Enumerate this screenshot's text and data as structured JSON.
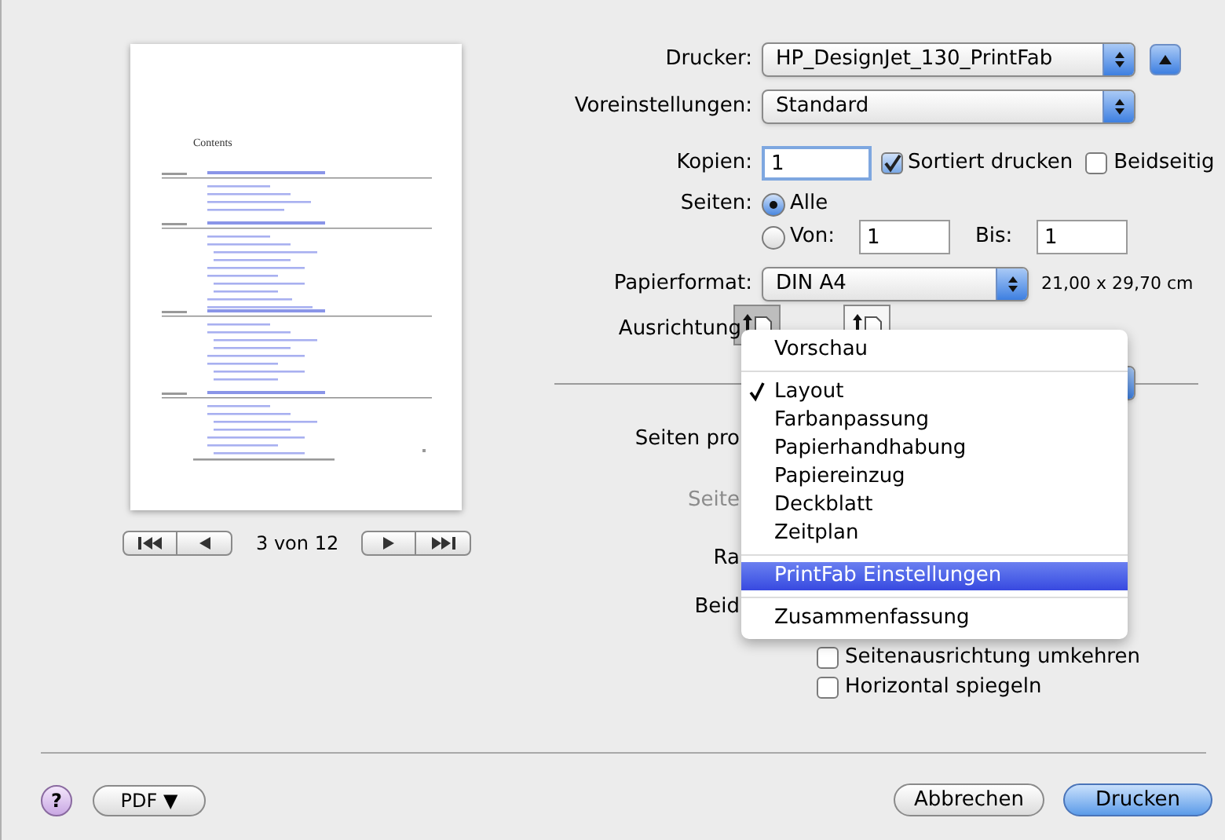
{
  "preview": {
    "heading": "Contents",
    "page_indicator": "3 von 12"
  },
  "printer": {
    "label": "Drucker:",
    "value": "HP_DesignJet_130_PrintFab",
    "expanded": true
  },
  "presets": {
    "label": "Voreinstellungen:",
    "value": "Standard"
  },
  "copies": {
    "label": "Kopien:",
    "value": "1"
  },
  "collate": {
    "label": "Sortiert drucken",
    "checked": true
  },
  "two_sided": {
    "label": "Beidseitig",
    "checked": false
  },
  "pages": {
    "label": "Seiten:",
    "options": [
      {
        "label": "Alle",
        "selected": true
      },
      {
        "label": "Von:",
        "selected": false
      }
    ],
    "from_value": "1",
    "to_label": "Bis:",
    "to_value": "1"
  },
  "paper_size": {
    "label": "Papierformat:",
    "value": "DIN A4",
    "dimensions": "21,00 x 29,70 cm"
  },
  "orientation": {
    "label": "Ausrichtung",
    "options": [
      {
        "selected": true
      },
      {
        "selected": false
      }
    ]
  },
  "layout_rows": [
    {
      "label": "Seiten pro",
      "disabled": false
    },
    {
      "label": "Seite",
      "disabled": true
    },
    {
      "label": "Ra",
      "disabled": false
    },
    {
      "label": "Beid",
      "disabled": false
    }
  ],
  "layout_checkboxes": [
    {
      "label": "Seitenausrichtung umkehren",
      "checked": false
    },
    {
      "label": "Horizontal spiegeln",
      "checked": false
    }
  ],
  "menu": {
    "items": [
      {
        "kind": "item",
        "label": "Vorschau",
        "checked": false,
        "selected": false
      },
      {
        "kind": "separator"
      },
      {
        "kind": "item",
        "label": "Layout",
        "checked": true,
        "selected": false
      },
      {
        "kind": "item",
        "label": "Farbanpassung",
        "checked": false,
        "selected": false
      },
      {
        "kind": "item",
        "label": "Papierhandhabung",
        "checked": false,
        "selected": false
      },
      {
        "kind": "item",
        "label": "Papiereinzug",
        "checked": false,
        "selected": false
      },
      {
        "kind": "item",
        "label": "Deckblatt",
        "checked": false,
        "selected": false
      },
      {
        "kind": "item",
        "label": "Zeitplan",
        "checked": false,
        "selected": false
      },
      {
        "kind": "separator"
      },
      {
        "kind": "item",
        "label": "PrintFab Einstellungen",
        "checked": false,
        "selected": true
      },
      {
        "kind": "separator"
      },
      {
        "kind": "item",
        "label": "Zusammenfassung",
        "checked": false,
        "selected": false
      }
    ]
  },
  "footer": {
    "help": "?",
    "pdf": "PDF ▼",
    "cancel": "Abbrechen",
    "print": "Drucken"
  }
}
